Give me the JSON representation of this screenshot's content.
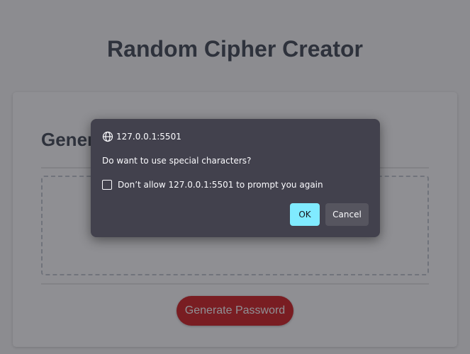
{
  "page": {
    "title": "Random Cipher Creator",
    "card_heading": "Generate a Password",
    "generate_button_label": "Generate Password"
  },
  "dialog": {
    "origin": "127.0.0.1:5501",
    "message": "Do want to use special characters?",
    "checkbox_label": "Don’t allow 127.0.0.1:5501 to prompt you again",
    "checkbox_checked": false,
    "ok_label": "OK",
    "cancel_label": "Cancel",
    "origin_icon": "globe-icon"
  },
  "colors": {
    "title_text": "#3d4450",
    "generate_button": "#d21a1d",
    "dialog_background": "#42414d",
    "ok_button": "#80ebff",
    "cancel_button": "#56555f"
  }
}
